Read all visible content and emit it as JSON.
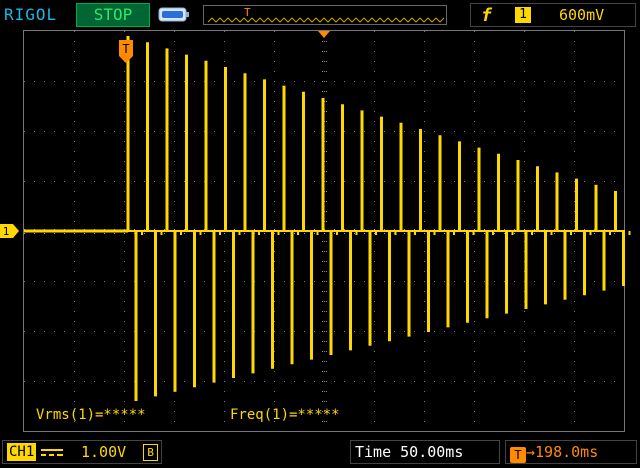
{
  "header": {
    "brand": "RIGOL",
    "run_state": "STOP",
    "trigger_edge_symbol": "f",
    "trigger_source": "1",
    "trigger_level": "600mV"
  },
  "screen": {
    "trigger_marker": "T",
    "channel_marker": "1",
    "measurements": [
      {
        "label": "Vrms(1)=*****"
      },
      {
        "label": "Freq(1)=*****"
      }
    ]
  },
  "footer": {
    "channel_label": "CH1",
    "channel_scale": "1.00V",
    "bandwidth_badge": "B",
    "timebase": "Time 50.00ms",
    "trigger_offset": "198.0ms",
    "offset_icon": "T"
  },
  "colors": {
    "trace": "#ffd800",
    "brand": "#18b8e8",
    "run_state": "#2ee86a",
    "offset": "#ff8a00"
  }
}
